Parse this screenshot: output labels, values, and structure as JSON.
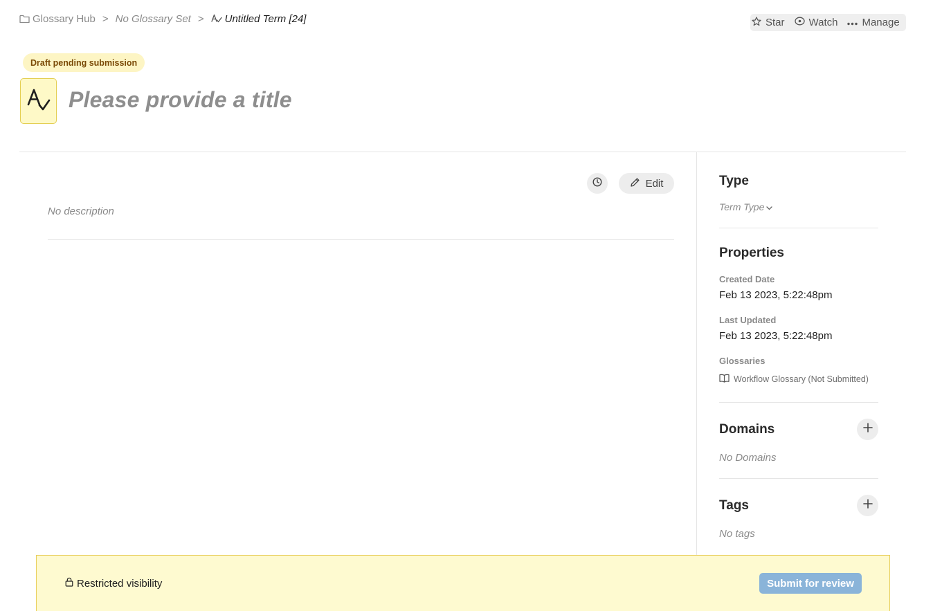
{
  "breadcrumb": {
    "hub": "Glossary Hub",
    "set": "No Glossary Set",
    "current": "Untitled Term [24]",
    "separator": ">"
  },
  "actions": {
    "star": "Star",
    "watch": "Watch",
    "manage": "Manage"
  },
  "status": "Draft pending submission",
  "title_placeholder": "Please provide a title",
  "main": {
    "edit_label": "Edit",
    "no_description": "No description"
  },
  "sidebar": {
    "type": {
      "heading": "Type",
      "value": "Term Type"
    },
    "properties": {
      "heading": "Properties",
      "created_label": "Created Date",
      "created_value": "Feb 13 2023, 5:22:48pm",
      "updated_label": "Last Updated",
      "updated_value": "Feb 13 2023, 5:22:48pm",
      "glossaries_label": "Glossaries",
      "glossary_value": "Workflow Glossary (Not Submitted)"
    },
    "domains": {
      "heading": "Domains",
      "empty": "No Domains"
    },
    "tags": {
      "heading": "Tags",
      "empty": "No tags"
    }
  },
  "footer": {
    "visibility": "Restricted visibility",
    "submit": "Submit for review"
  },
  "colors": {
    "accent_yellow": "#fefad0",
    "status_text": "#7a4a06",
    "submit_disabled": "#8ab4d9"
  }
}
